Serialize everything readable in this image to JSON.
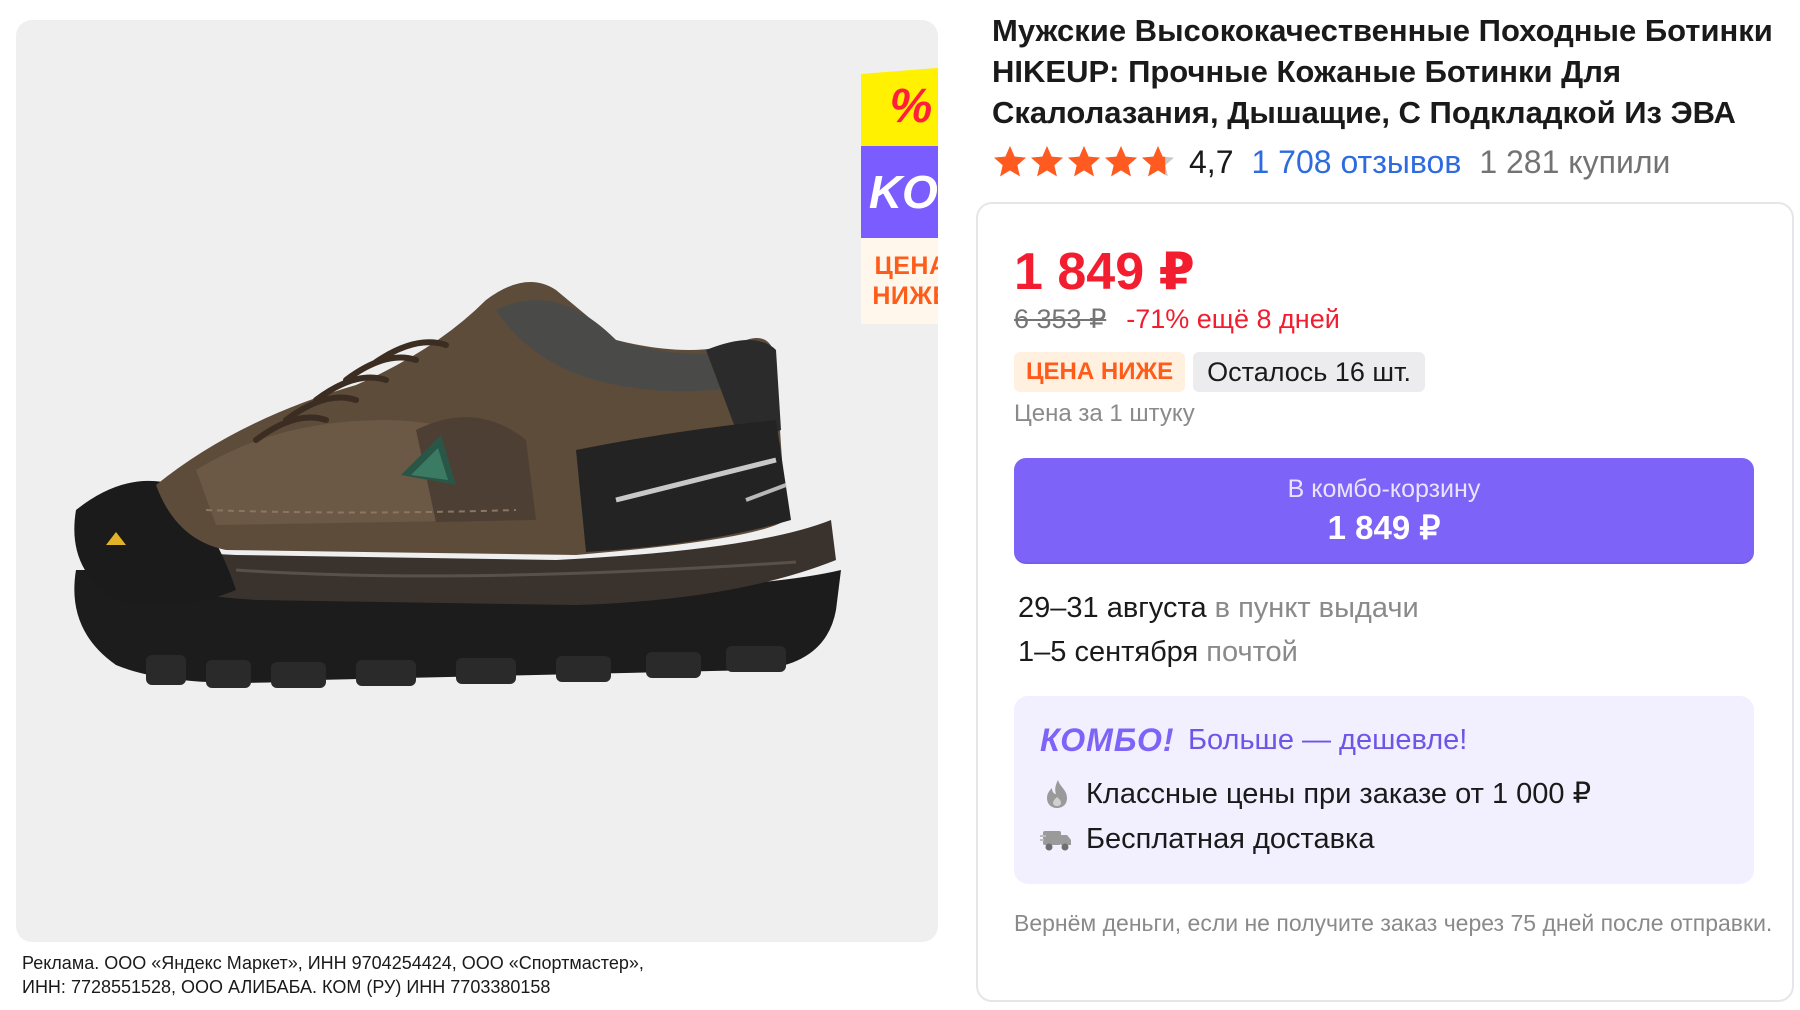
{
  "product": {
    "title_lines": [
      "Мужские Высококачественные Походные Ботинки",
      "HIKEUP: Прочные Кожаные Ботинки Для",
      "Скалолазания, Дышащие, С Подкладкой Из ЭВА"
    ],
    "rating": "4,7",
    "stars": 4.7,
    "reviews": "1 708 отзывов",
    "bought": "1 281 купили"
  },
  "promo_badge": {
    "top": "%",
    "middle": "KO!",
    "bottom_line1": "ЦЕНА",
    "bottom_line2": "НИЖЕ"
  },
  "price": {
    "current": "1 849 ₽",
    "old": "6 353 ₽",
    "discount": "-71% ещё 8 дней",
    "badge_lower": "ЦЕНА НИЖЕ",
    "stock": "Осталось 16 шт.",
    "per_unit": "Цена за 1 штуку"
  },
  "cart_button": {
    "label": "В комбо-корзину",
    "price": "1 849 ₽"
  },
  "delivery": [
    {
      "date": "29–31 августа",
      "method": "в пункт выдачи"
    },
    {
      "date": "1–5 сентября",
      "method": "почтой"
    }
  ],
  "combo": {
    "logo": "КОМБО!",
    "tagline": "Больше — дешевле!",
    "line1": "Классные цены при заказе от 1 000 ₽",
    "line2": "Бесплатная доставка"
  },
  "refund": "Вернём деньги, если не получите заказ через 75 дней после отправки.",
  "ad_text": [
    "Реклама. ООО «Яндекс Маркет», ИНН 9704254424, ООО «Спортмастер»,",
    "ИНН: 7728551528, ООО АЛИБАБА. КОМ (РУ) ИНН 7703380158"
  ],
  "icons": {
    "star": "star-icon",
    "flame": "flame-icon",
    "truck": "delivery-truck-icon"
  },
  "colors": {
    "price_red": "#f21d2f",
    "accent_purple": "#7d63f7",
    "link_blue": "#2d6bdf",
    "star_orange": "#ff5a1f",
    "badge_orange": "#ff5c1a"
  }
}
